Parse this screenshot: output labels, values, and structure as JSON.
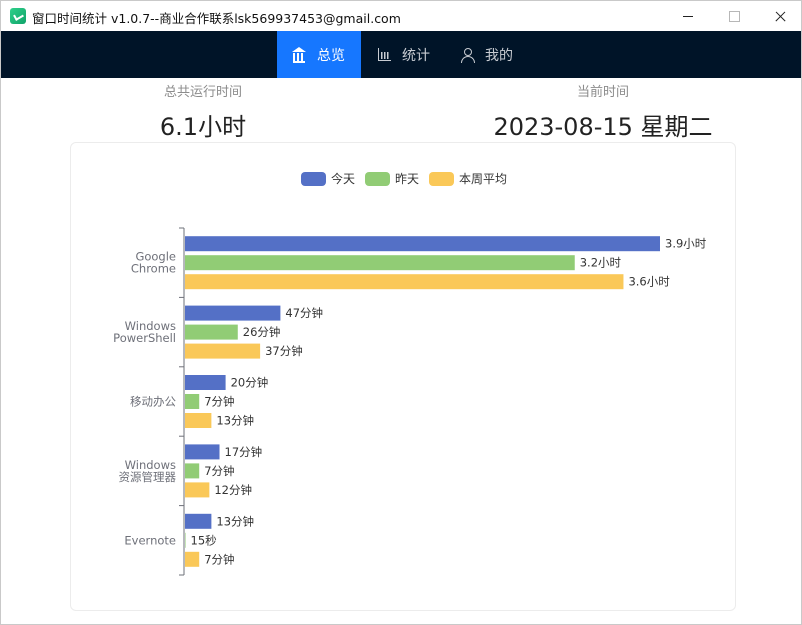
{
  "window": {
    "title": "窗口时间统计 v1.0.7--商业合作联系lsk569937453@gmail.com"
  },
  "nav": {
    "items": [
      {
        "label": "总览",
        "icon": "bank-icon",
        "active": true
      },
      {
        "label": "统计",
        "icon": "bar-chart-icon",
        "active": false
      },
      {
        "label": "我的",
        "icon": "user-icon",
        "active": false
      }
    ]
  },
  "stats": {
    "run_label": "总共运行时间",
    "run_value": "6.1小时",
    "now_label": "当前时间",
    "now_value": "2023-08-15 星期二"
  },
  "colors": {
    "nav_bg": "#001428",
    "nav_active": "#1677ff",
    "today": "#5470c6",
    "yesterday": "#91cc75",
    "week_avg": "#fac858"
  },
  "chart_data": {
    "type": "bar",
    "orientation": "horizontal",
    "unit": "minutes",
    "categories": [
      "Google\nChrome",
      "Windows\nPowerShell",
      "移动办公",
      "Windows\n资源管理器",
      "Evernote"
    ],
    "series": [
      {
        "name": "今天",
        "color": "#5470c6",
        "values": [
          234,
          47,
          20,
          17,
          13
        ],
        "labels": [
          "3.9小时",
          "47分钟",
          "20分钟",
          "17分钟",
          "13分钟"
        ]
      },
      {
        "name": "昨天",
        "color": "#91cc75",
        "values": [
          192,
          26,
          7,
          7,
          0.25
        ],
        "labels": [
          "3.2小时",
          "26分钟",
          "7分钟",
          "7分钟",
          "15秒"
        ]
      },
      {
        "name": "本周平均",
        "color": "#fac858",
        "values": [
          216,
          37,
          13,
          12,
          7
        ],
        "labels": [
          "3.6小时",
          "37分钟",
          "13分钟",
          "12分钟",
          "7分钟"
        ]
      }
    ],
    "legend_position": "top-center",
    "grid": false
  }
}
